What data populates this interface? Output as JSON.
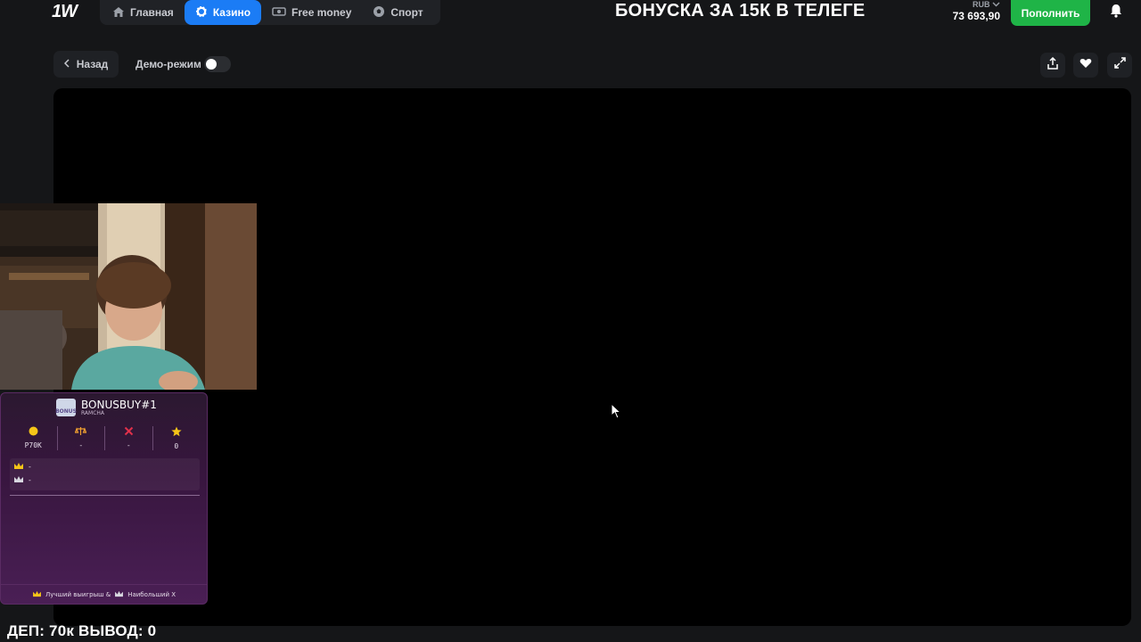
{
  "topbar": {
    "logo": "1W",
    "nav": [
      {
        "label": "Главная",
        "icon": "home-icon",
        "active": false
      },
      {
        "label": "Казино",
        "icon": "casino-chip-icon",
        "active": true
      },
      {
        "label": "Free money",
        "icon": "money-icon",
        "active": false
      },
      {
        "label": "Спорт",
        "icon": "soccer-ball-icon",
        "active": false
      }
    ],
    "banner": "БОНУСКА ЗА 15К В ТЕЛЕГЕ",
    "currency": "RUB",
    "balance": "73 693,90",
    "deposit_label": "Пополнить"
  },
  "subbar": {
    "back_label": "Назад",
    "demo_label": "Демо-режим",
    "demo_enabled": false
  },
  "widget": {
    "title": "BONUSBUY#1",
    "subtitle": "RAMCHA",
    "logo_text": "BONUS",
    "stats": [
      {
        "icon": "coin-icon",
        "value": "Р70К",
        "color": "#f5c518"
      },
      {
        "icon": "scales-icon",
        "value": "-",
        "color": "#f0a030"
      },
      {
        "icon": "cross-icon",
        "value": "-",
        "color": "#e0304a"
      },
      {
        "icon": "star-icon",
        "value": "0",
        "color": "#f5c518"
      }
    ],
    "rows": [
      {
        "icon": "crown-icon",
        "value": "-"
      },
      {
        "icon": "crown-outline-icon",
        "value": "-"
      }
    ],
    "footer_best": "Лучший выигрыш &",
    "footer_biggest": "Наибольший X"
  },
  "overlay_text": "ДЕП: 70к ВЫВОД: 0",
  "colors": {
    "accent": "#1b7cf5",
    "deposit": "#1fb447",
    "background": "#151618"
  }
}
